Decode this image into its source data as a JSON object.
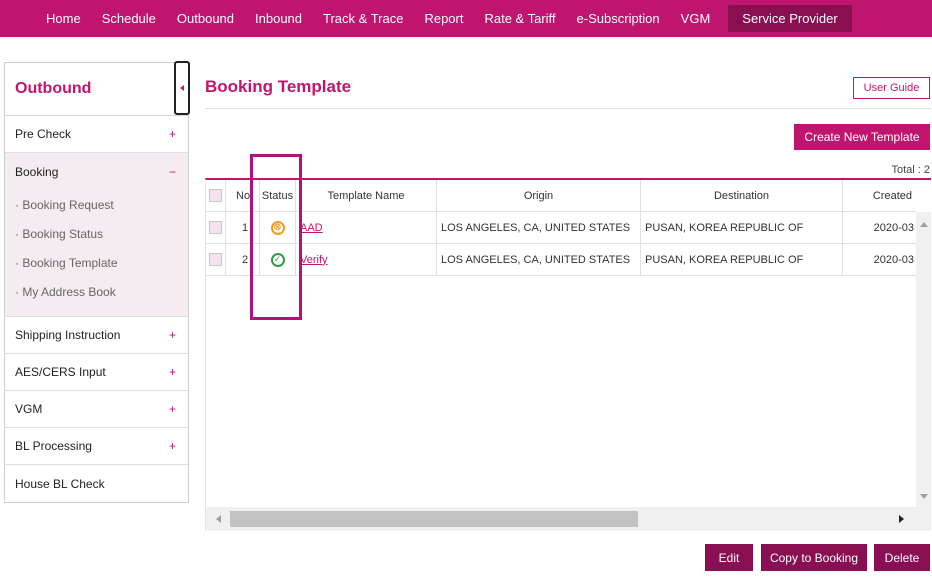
{
  "nav": {
    "items": [
      "Home",
      "Schedule",
      "Outbound",
      "Inbound",
      "Track & Trace",
      "Report",
      "Rate & Tariff",
      "e-Subscription",
      "VGM"
    ],
    "active": "Service Provider"
  },
  "sidebar": {
    "title": "Outbound",
    "items": [
      {
        "label": "Pre Check",
        "toggle": "+"
      },
      {
        "label": "Booking",
        "toggle": "−",
        "sub": [
          "· Booking Request",
          "· Booking Status",
          "· Booking Template",
          "· My Address Book"
        ]
      },
      {
        "label": "Shipping Instruction",
        "toggle": "+"
      },
      {
        "label": "AES/CERS Input",
        "toggle": "+"
      },
      {
        "label": "VGM",
        "toggle": "+"
      },
      {
        "label": "BL Processing",
        "toggle": "+"
      },
      {
        "label": "House BL Check",
        "toggle": ""
      }
    ]
  },
  "main": {
    "title": "Booking Template",
    "user_guide": "User Guide",
    "create_button": "Create New Template",
    "total": "Total : 2"
  },
  "grid": {
    "columns": [
      "",
      "No",
      "Status",
      "Template Name",
      "Origin",
      "Destination",
      "Created"
    ],
    "rows": [
      {
        "no": "1",
        "status": "error",
        "status_glyph": "⊗",
        "name": "AAD",
        "origin": "LOS ANGELES, CA, UNITED STATES",
        "destination": "PUSAN, KOREA REPUBLIC OF",
        "created": "2020-03"
      },
      {
        "no": "2",
        "status": "ok",
        "status_glyph": "✓",
        "name": "Verify",
        "origin": "LOS ANGELES, CA, UNITED STATES",
        "destination": "PUSAN, KOREA REPUBLIC OF",
        "created": "2020-03"
      }
    ]
  },
  "actions": {
    "edit": "Edit",
    "copy": "Copy to Booking",
    "delete": "Delete"
  },
  "colors": {
    "brand": "#c0156e",
    "brand_dark": "#8a0f52",
    "status_error": "#f39a1e",
    "status_ok": "#2f9e3e"
  }
}
